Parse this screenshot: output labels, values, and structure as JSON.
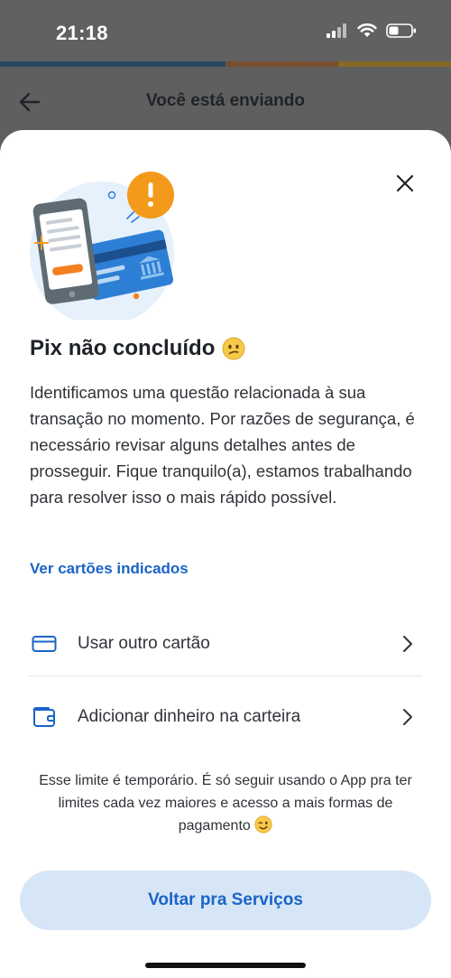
{
  "status_bar": {
    "time": "21:18",
    "icons": [
      "signal-icon",
      "wifi-icon",
      "battery-icon"
    ]
  },
  "header": {
    "back_icon": "arrow-left-icon",
    "title": "Você está enviando"
  },
  "sheet": {
    "close_icon": "close-icon",
    "illustration": "phone-card-alert-illustration",
    "title": "Pix não concluído",
    "title_emoji": "confused-face-emoji",
    "body": "Identificamos uma questão relacionada à sua transação no momento. Por razões de segurança, é necessário revisar alguns detalhes antes de prosseguir. Fique tranquilo(a), estamos trabalhando para resolver isso o mais rápido possível.",
    "link": "Ver cartões indicados",
    "options": [
      {
        "icon": "credit-card-icon",
        "label": "Usar outro cartão"
      },
      {
        "icon": "wallet-icon",
        "label": "Adicionar dinheiro na carteira"
      }
    ],
    "note": "Esse limite é temporário. É só seguir usando o App pra ter limites cada vez maiores e acesso a mais formas de pagamento",
    "note_emoji": "winking-face-emoji",
    "primary_button": "Voltar pra Serviços"
  },
  "colors": {
    "accent_blue": "#1a64c6",
    "button_bg": "#d7e6f6",
    "alert_orange": "#f39a1a",
    "overlay": "#5f5f5f"
  }
}
